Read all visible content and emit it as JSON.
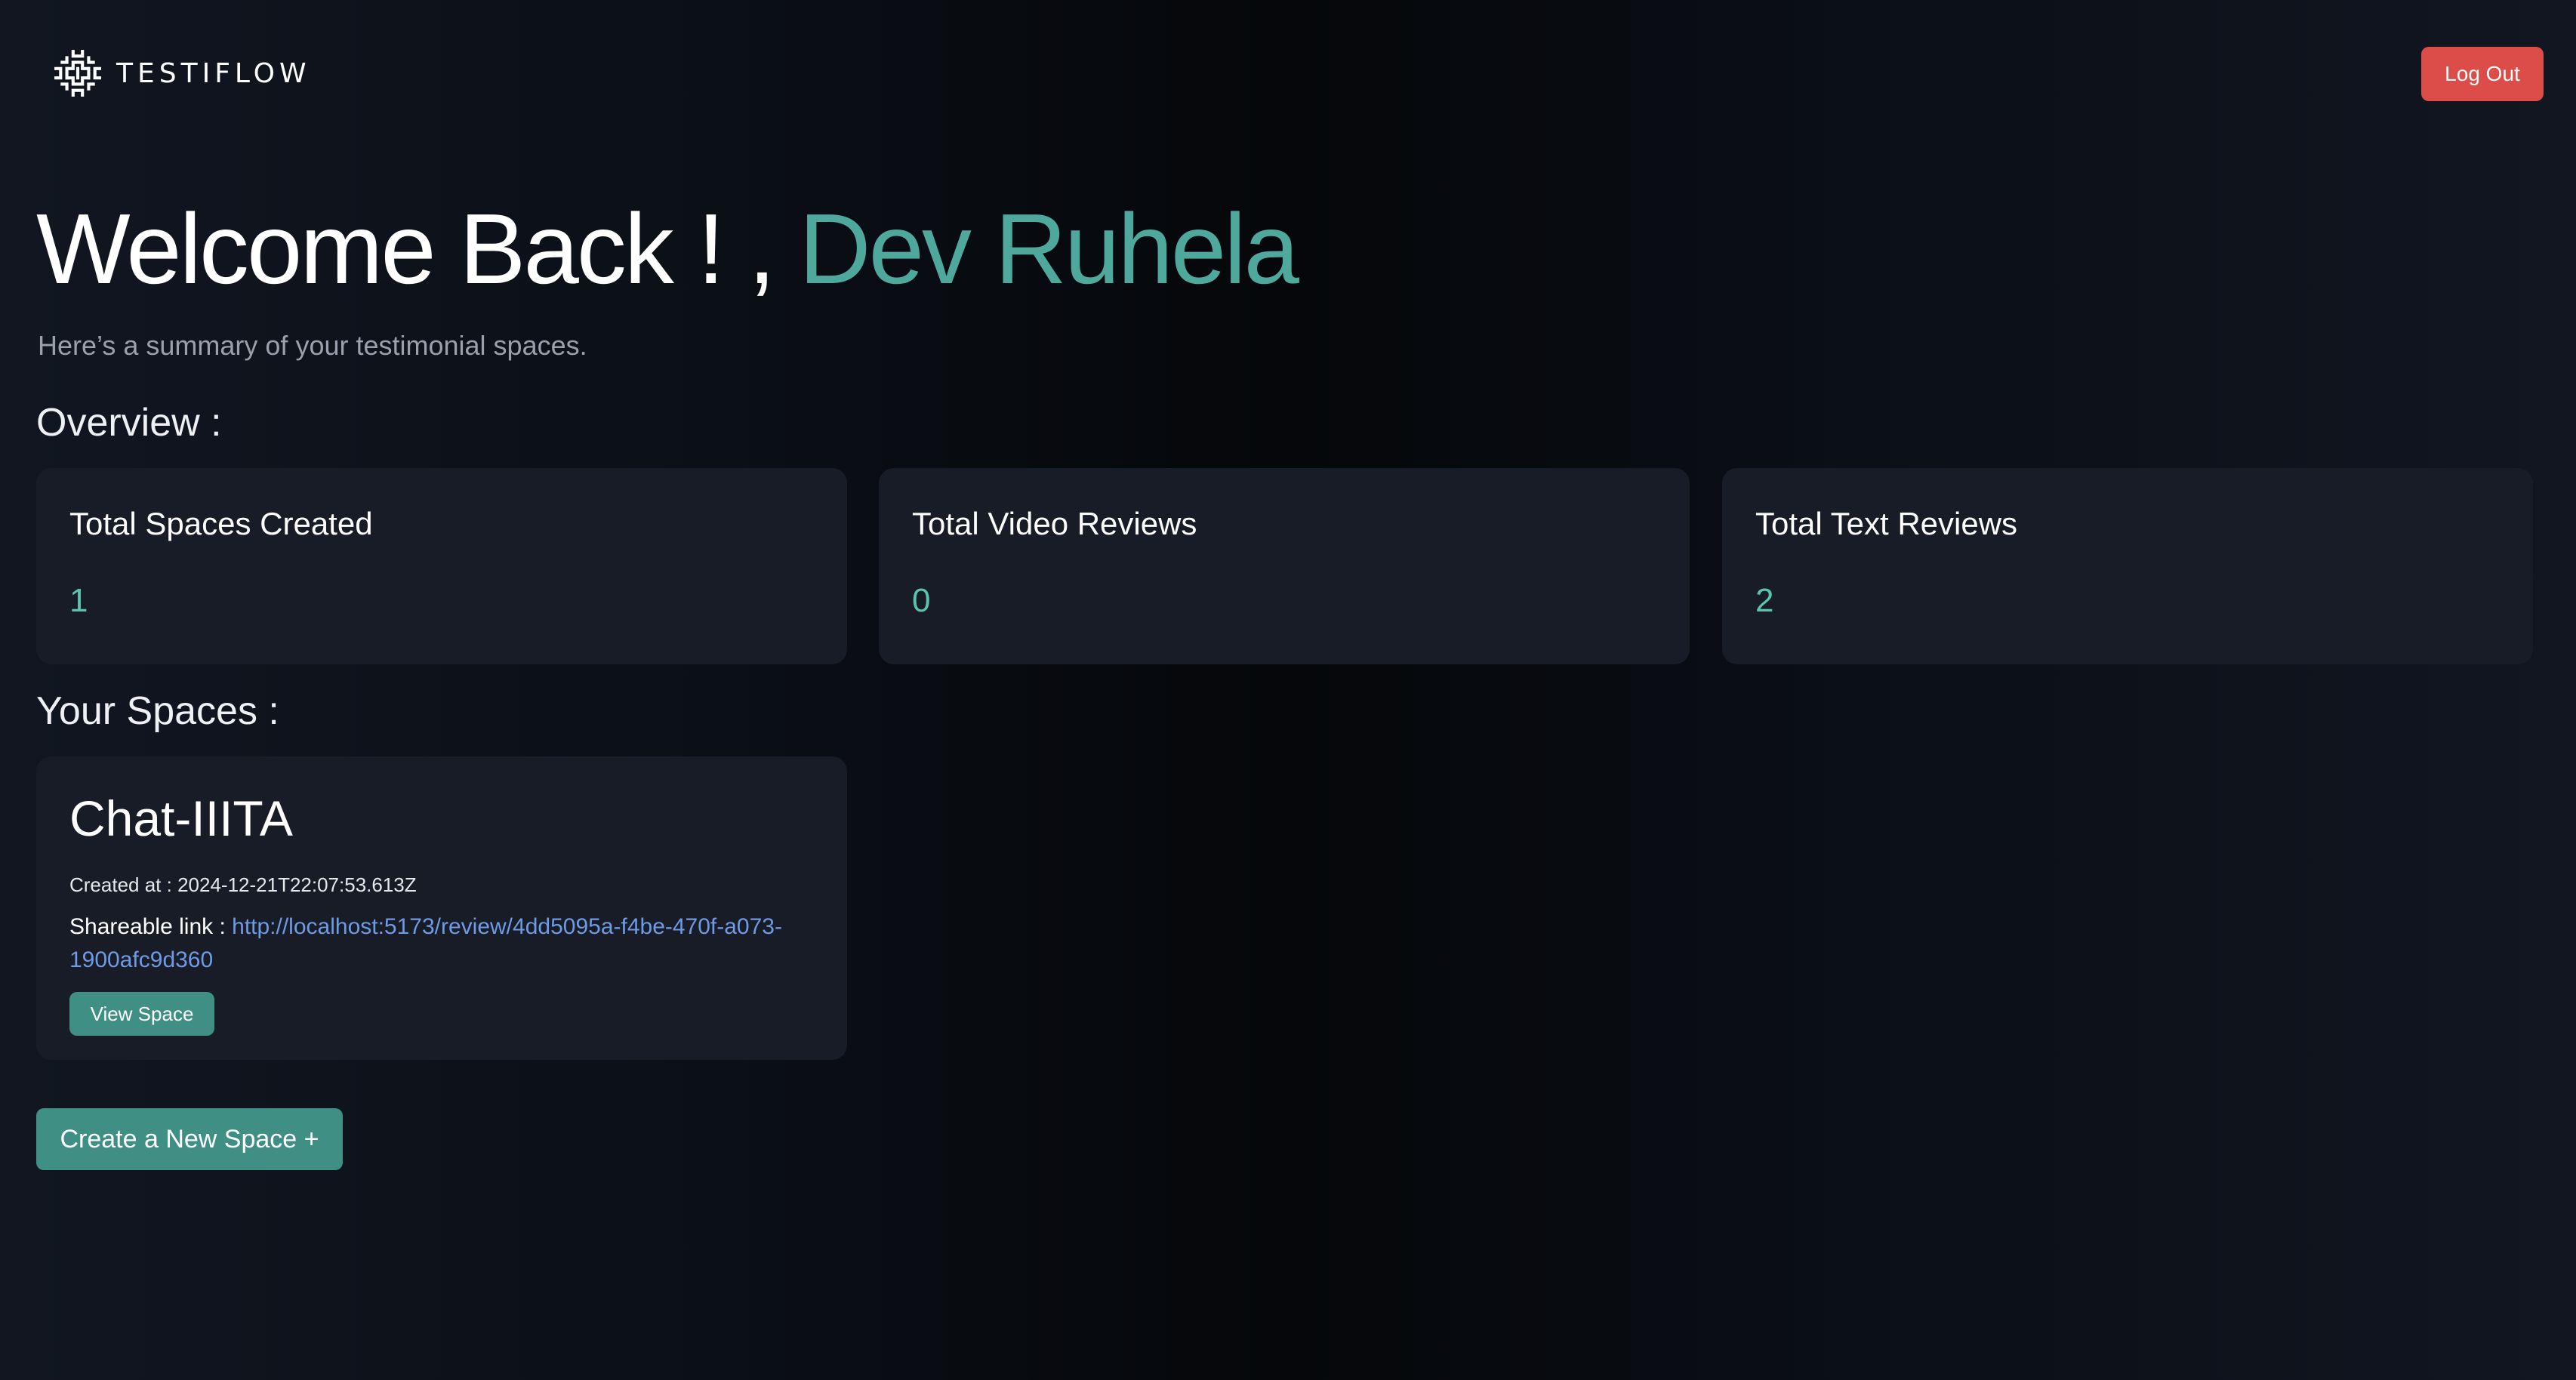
{
  "header": {
    "brand_name": "TESTIFLOW",
    "logout_label": "Log Out"
  },
  "welcome": {
    "greeting": "Welcome Back ! , ",
    "user_name": "Dev Ruhela",
    "subtitle": "Here’s a summary of your testimonial spaces."
  },
  "overview": {
    "title": "Overview :",
    "stats": [
      {
        "label": "Total Spaces Created",
        "value": "1"
      },
      {
        "label": "Total Video Reviews",
        "value": "0"
      },
      {
        "label": "Total Text Reviews",
        "value": "2"
      }
    ]
  },
  "spaces": {
    "title": "Your Spaces :",
    "items": [
      {
        "name": "Chat-IIITA",
        "created_label": "Created at : ",
        "created_at": "2024-12-21T22:07:53.613Z",
        "link_label": "Shareable link : ",
        "link": "http://localhost:5173/review/4dd5095a-f4be-470f-a073-1900afc9d360",
        "view_label": "View Space"
      }
    ]
  },
  "create_button_label": "Create a New Space +",
  "colors": {
    "accent": "#4fa89c",
    "stat_value": "#5cc3b1",
    "logout": "#dc4c48",
    "button": "#3f8f85",
    "link": "#6f9ae6",
    "card_bg": "#181c26"
  },
  "icons": {
    "brand_logo": "maze-logo-icon"
  }
}
